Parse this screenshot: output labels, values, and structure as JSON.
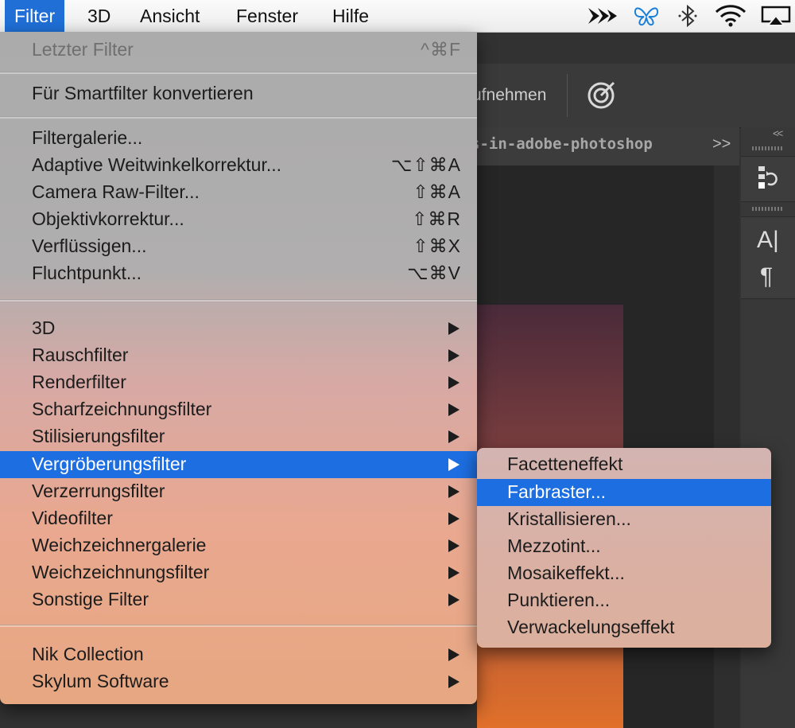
{
  "menubar": {
    "items": [
      "Filter",
      "3D",
      "Ansicht",
      "Fenster",
      "Hilfe"
    ]
  },
  "background": {
    "options_text": "ufnehmen",
    "doc_tab_title": "s-in-adobe-photoshop",
    "doc_tab_more": ">>",
    "panel_collapse": "<<"
  },
  "filter_menu": {
    "last_filter": {
      "label": "Letzter Filter",
      "shortcut": "^⌘F"
    },
    "smart": {
      "label": "Für Smartfilter konvertieren"
    },
    "group1": [
      {
        "label": "Filtergalerie...",
        "shortcut": ""
      },
      {
        "label": "Adaptive Weitwinkelkorrektur...",
        "shortcut": "⌥⇧⌘A"
      },
      {
        "label": "Camera Raw-Filter...",
        "shortcut": "⇧⌘A"
      },
      {
        "label": "Objektivkorrektur...",
        "shortcut": "⇧⌘R"
      },
      {
        "label": "Verflüssigen...",
        "shortcut": "⇧⌘X"
      },
      {
        "label": "Fluchtpunkt...",
        "shortcut": "⌥⌘V"
      }
    ],
    "group2": [
      {
        "label": "3D"
      },
      {
        "label": "Rauschfilter"
      },
      {
        "label": "Renderfilter"
      },
      {
        "label": "Scharfzeichnungsfilter"
      },
      {
        "label": "Stilisierungsfilter"
      },
      {
        "label": "Vergröberungsfilter"
      },
      {
        "label": "Verzerrungsfilter"
      },
      {
        "label": "Videofilter"
      },
      {
        "label": "Weichzeichnergalerie"
      },
      {
        "label": "Weichzeichnungsfilter"
      },
      {
        "label": "Sonstige Filter"
      }
    ],
    "group3": [
      {
        "label": "Nik Collection"
      },
      {
        "label": "Skylum Software"
      }
    ]
  },
  "submenu": {
    "items": [
      {
        "label": "Facetteneffekt"
      },
      {
        "label": "Farbraster..."
      },
      {
        "label": "Kristallisieren..."
      },
      {
        "label": "Mezzotint..."
      },
      {
        "label": "Mosaikeffekt..."
      },
      {
        "label": "Punktieren..."
      },
      {
        "label": "Verwackelungseffekt"
      }
    ]
  },
  "right_panel_icons": [
    "A|",
    "¶"
  ],
  "colors": {
    "selection": "#1d6ee0",
    "menubar_active": "#1f6fd6"
  }
}
